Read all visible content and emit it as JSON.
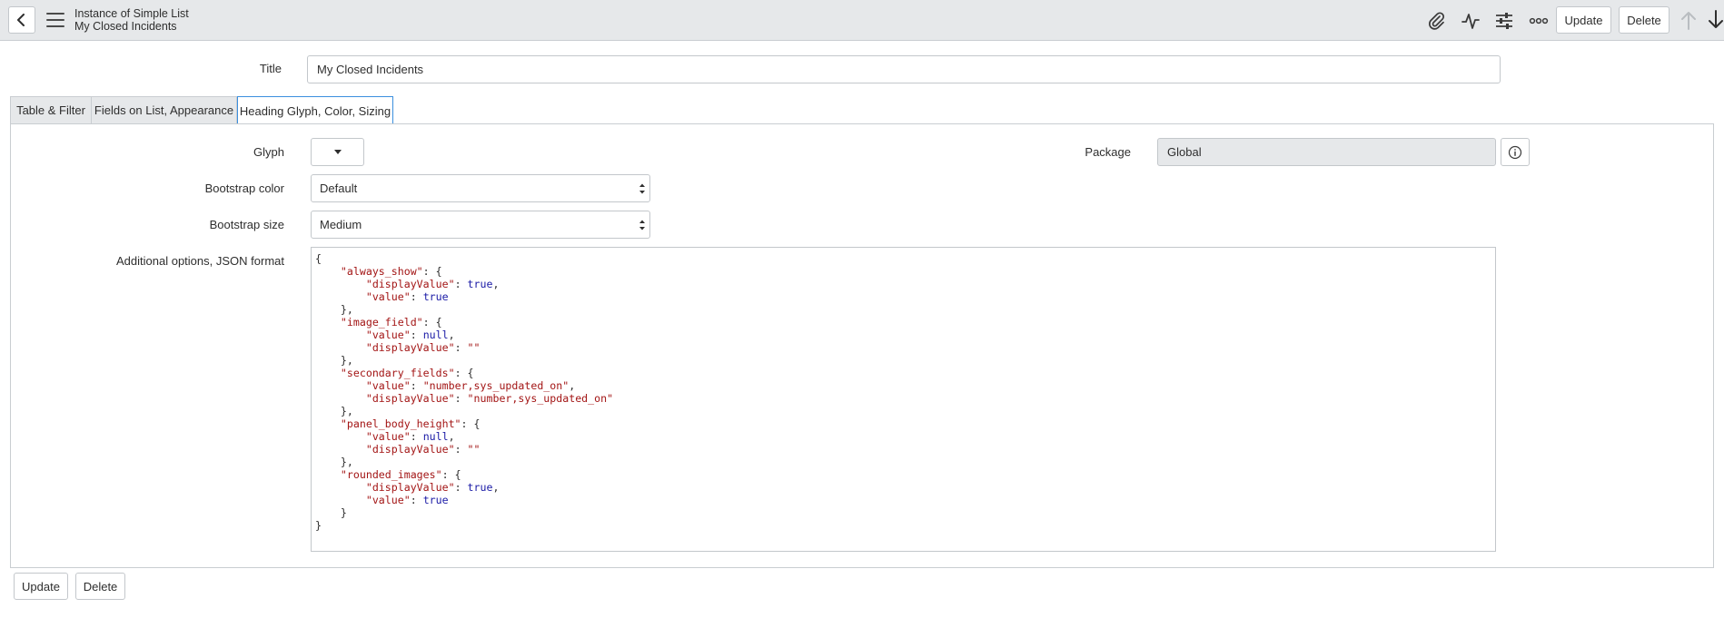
{
  "header": {
    "record_type": "Instance of Simple List",
    "record_name": "My Closed Incidents",
    "update_label": "Update",
    "delete_label": "Delete"
  },
  "form": {
    "title_label": "Title",
    "title_value": "My Closed Incidents",
    "tabs": [
      {
        "label": "Table & Filter",
        "active": false
      },
      {
        "label": "Fields on List, Appearance",
        "active": false
      },
      {
        "label": "Heading Glyph, Color, Sizing",
        "active": true
      }
    ],
    "glyph_label": "Glyph",
    "package_label": "Package",
    "package_value": "Global",
    "bootstrap_color_label": "Bootstrap color",
    "bootstrap_color_value": "Default",
    "bootstrap_size_label": "Bootstrap size",
    "bootstrap_size_value": "Medium",
    "json_label": "Additional options, JSON format",
    "json_lines": [
      "{",
      "    \"always_show\": {",
      "        \"displayValue\": true,",
      "        \"value\": true",
      "    },",
      "    \"image_field\": {",
      "        \"value\": null,",
      "        \"displayValue\": \"\"",
      "    },",
      "    \"secondary_fields\": {",
      "        \"value\": \"number,sys_updated_on\",",
      "        \"displayValue\": \"number,sys_updated_on\"",
      "    },",
      "    \"panel_body_height\": {",
      "        \"value\": null,",
      "        \"displayValue\": \"\"",
      "    },",
      "    \"rounded_images\": {",
      "        \"displayValue\": true,",
      "        \"value\": true",
      "    }",
      "}"
    ]
  },
  "footer": {
    "update_label": "Update",
    "delete_label": "Delete"
  },
  "colors": {
    "header_bg": "#e6e8ea",
    "active_tab_border": "#3b8fde",
    "json_key": "#a31515",
    "json_keyword": "#1a1aa6"
  }
}
